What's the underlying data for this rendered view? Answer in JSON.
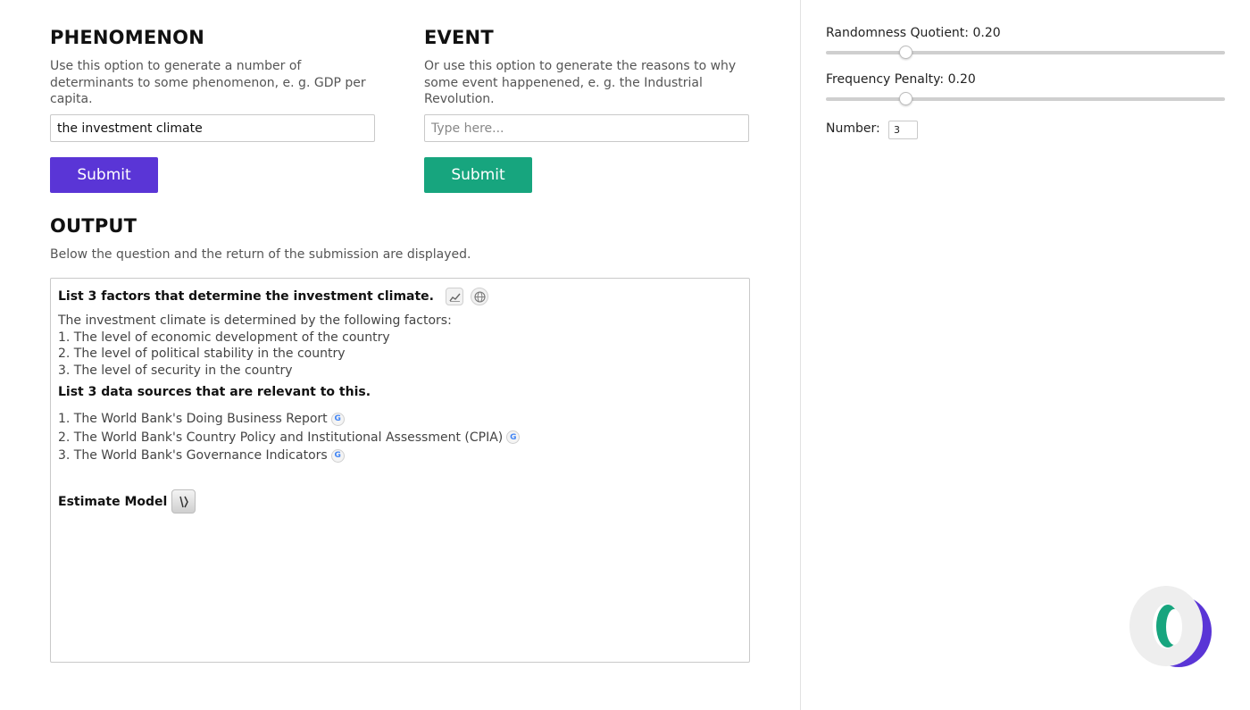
{
  "phenomenon": {
    "title": "PHENOMENON",
    "description": "Use this option to generate a number of determinants to some phenomenon, e. g. GDP per capita.",
    "input_value": "the investment climate",
    "submit_label": "Submit"
  },
  "event": {
    "title": "EVENT",
    "description": "Or use this option to generate the reasons to why some event happenened, e. g. the Industrial Revolution.",
    "input_placeholder": "Type here...",
    "submit_label": "Submit"
  },
  "output": {
    "title": "OUTPUT",
    "description": "Below the question and the return of the submission are displayed.",
    "question1": "List 3 factors that determine the investment climate.",
    "answer_intro": "The investment climate is determined by the following factors:",
    "factors": [
      "1. The level of economic development of the country",
      "2. The level of political stability in the country",
      "3. The level of security in the country"
    ],
    "question2": "List 3 data sources that are relevant to this.",
    "sources": [
      "1. The World Bank's Doing Business Report",
      "2. The World Bank's Country Policy and Institutional Assessment (CPIA)",
      "3. The World Bank's Governance Indicators"
    ],
    "estimate_label": "Estimate Model"
  },
  "settings": {
    "randomness_label": "Randomness Quotient: 0.20",
    "randomness_value": 0.2,
    "frequency_label": "Frequency Penalty: 0.20",
    "frequency_value": 0.2,
    "number_label": "Number:",
    "number_value": "3"
  },
  "colors": {
    "purple": "#5a35d6",
    "green": "#17a57e"
  }
}
